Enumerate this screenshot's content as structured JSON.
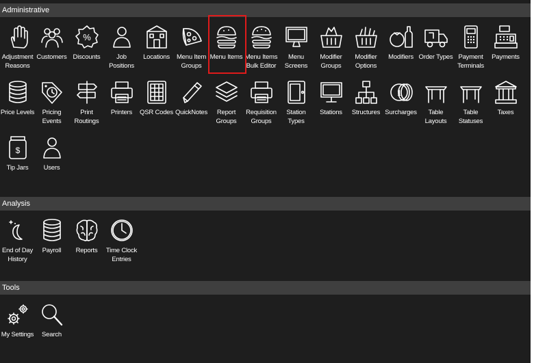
{
  "colors": {
    "background": "#1e1e1e",
    "header": "#3f3f3f",
    "text": "#ffffff",
    "highlight": "#e01b1b"
  },
  "sections": {
    "administrative": {
      "title": "Administrative",
      "items": [
        {
          "label": "Adjustment\nReasons",
          "icon": "hand-icon"
        },
        {
          "label": "Customers",
          "icon": "customers-icon"
        },
        {
          "label": "Discounts",
          "icon": "discount-badge-icon"
        },
        {
          "label": "Job\nPositions",
          "icon": "person-icon"
        },
        {
          "label": "Locations",
          "icon": "building-icon"
        },
        {
          "label": "Menu Item\nGroups",
          "icon": "pizza-icon"
        },
        {
          "label": "Menu Items",
          "icon": "burger-icon",
          "highlighted": true
        },
        {
          "label": "Menu Items\nBulk Editor",
          "icon": "burger-edit-icon"
        },
        {
          "label": "Menu\nScreens",
          "icon": "monitor-icon"
        },
        {
          "label": "Modifier\nGroups",
          "icon": "basket-icon"
        },
        {
          "label": "Modifier\nOptions",
          "icon": "basket-options-icon"
        },
        {
          "label": "Modifiers",
          "icon": "tomato-bottle-icon"
        },
        {
          "label": "Order Types",
          "icon": "delivery-truck-icon"
        },
        {
          "label": "Payment\nTerminals",
          "icon": "card-terminal-icon"
        },
        {
          "label": "Payments",
          "icon": "cash-register-icon"
        },
        {
          "label": "Price Levels",
          "icon": "coin-stack-icon"
        },
        {
          "label": "Pricing\nEvents",
          "icon": "price-tag-clock-icon"
        },
        {
          "label": "Print\nRoutings",
          "icon": "signpost-icon"
        },
        {
          "label": "Printers",
          "icon": "printer-icon"
        },
        {
          "label": "QSR Codes",
          "icon": "keypad-icon"
        },
        {
          "label": "QuickNotes",
          "icon": "pencil-icon"
        },
        {
          "label": "Report\nGroups",
          "icon": "layers-icon"
        },
        {
          "label": "Requisition\nGroups",
          "icon": "printer-stack-icon"
        },
        {
          "label": "Station\nTypes",
          "icon": "tablet-icon"
        },
        {
          "label": "Stations",
          "icon": "monitor-stand-icon"
        },
        {
          "label": "Structures",
          "icon": "hierarchy-icon"
        },
        {
          "label": "Surcharges",
          "icon": "coin-one-icon"
        },
        {
          "label": "Table\nLayouts",
          "icon": "table-icon"
        },
        {
          "label": "Table\nStatuses",
          "icon": "table-status-icon"
        },
        {
          "label": "Taxes",
          "icon": "government-building-icon"
        },
        {
          "label": "Tip Jars",
          "icon": "tip-jar-icon"
        },
        {
          "label": "Users",
          "icon": "user-icon"
        }
      ]
    },
    "analysis": {
      "title": "Analysis",
      "items": [
        {
          "label": "End of Day\nHistory",
          "icon": "moon-stars-icon"
        },
        {
          "label": "Payroll",
          "icon": "coin-stack-icon"
        },
        {
          "label": "Reports",
          "icon": "brain-icon"
        },
        {
          "label": "Time Clock\nEntries",
          "icon": "clock-icon"
        }
      ]
    },
    "tools": {
      "title": "Tools",
      "items": [
        {
          "label": "My Settings",
          "icon": "gears-icon"
        },
        {
          "label": "Search",
          "icon": "search-icon"
        }
      ]
    }
  }
}
